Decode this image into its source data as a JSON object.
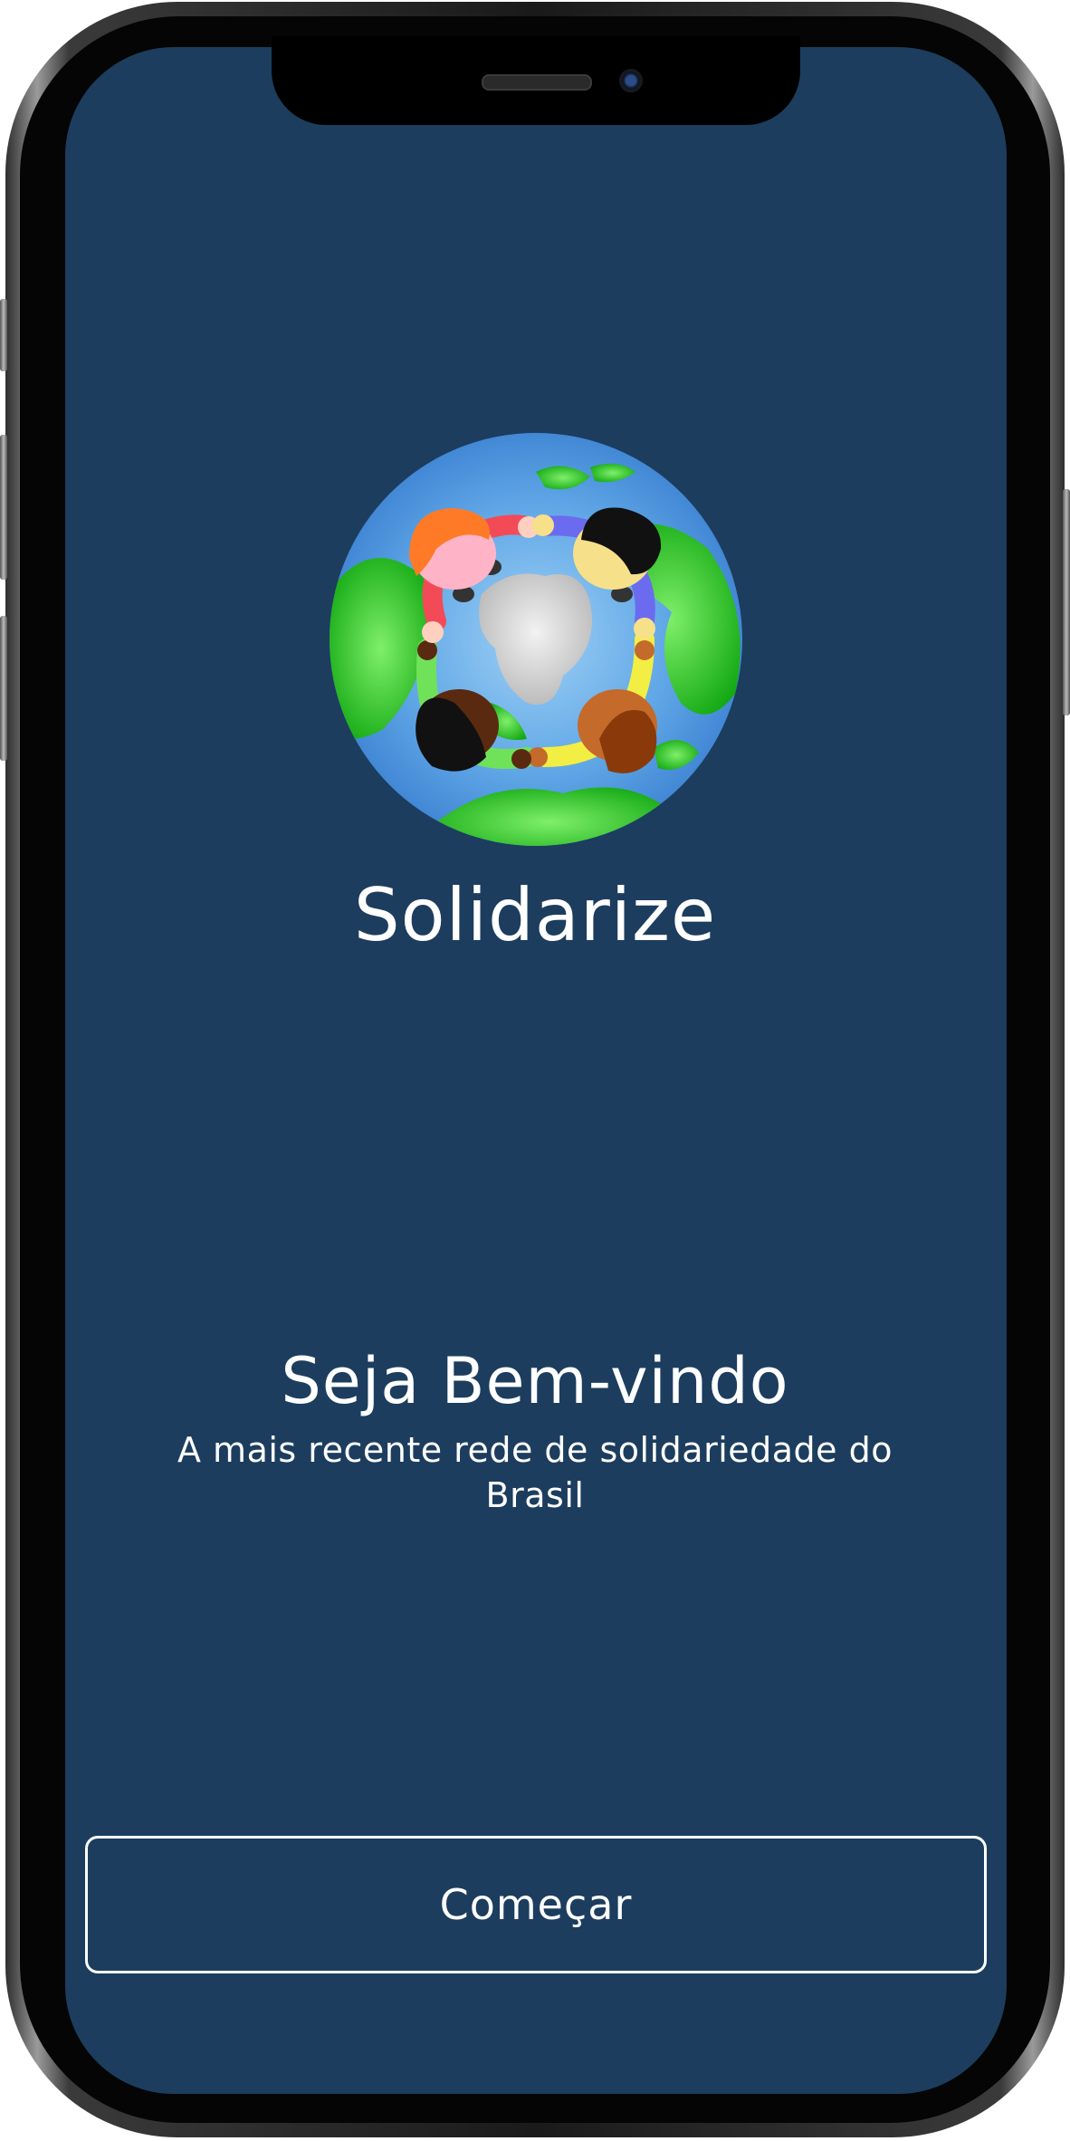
{
  "app": {
    "name": "Solidarize",
    "logo_icon": "globe-people-holding-hands-icon"
  },
  "welcome": {
    "title": "Seja Bem-vindo",
    "subtitle": "A mais recente rede de solidariedade do Brasil"
  },
  "actions": {
    "start_label": "Começar"
  },
  "colors": {
    "background": "#1c3d5e",
    "text": "#ffffff",
    "button_border": "#ffffff"
  }
}
